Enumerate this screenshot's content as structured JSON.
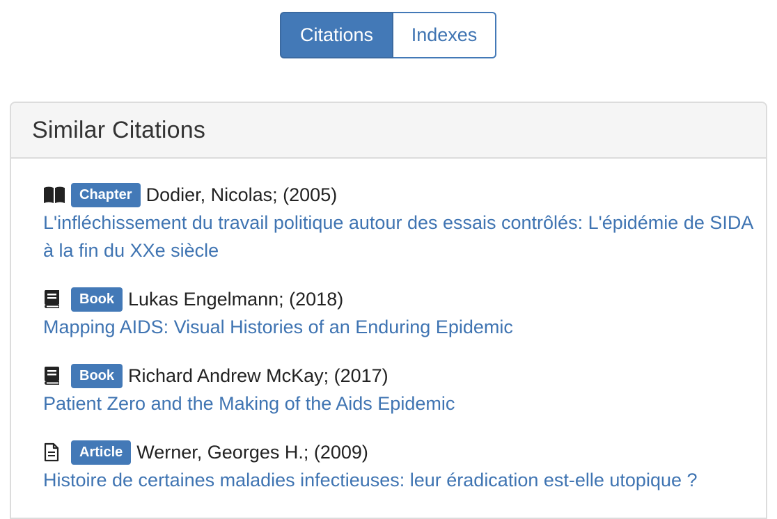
{
  "tabs": {
    "citations_label": "Citations",
    "indexes_label": "Indexes"
  },
  "panel": {
    "title": "Similar Citations"
  },
  "citations": [
    {
      "icon": "book-open-icon",
      "type": "Chapter",
      "author_year": "Dodier, Nicolas; (2005)",
      "title": "L'infléchissement du travail politique autour des essais contrôlés: L'épidémie de SIDA à la fin du XXe siècle"
    },
    {
      "icon": "book-icon",
      "type": "Book",
      "author_year": "Lukas Engelmann; (2018)",
      "title": "Mapping AIDS: Visual Histories of an Enduring Epidemic"
    },
    {
      "icon": "book-icon",
      "type": "Book",
      "author_year": "Richard Andrew McKay; (2017)",
      "title": "Patient Zero and the Making of the Aids Epidemic"
    },
    {
      "icon": "document-icon",
      "type": "Article",
      "author_year": "Werner, Georges H.; (2009)",
      "title": "Histoire de certaines maladies infectieuses: leur éradication est-elle utopique ?"
    }
  ],
  "colors": {
    "accent": "#4379b7",
    "link": "#3f74b2"
  }
}
